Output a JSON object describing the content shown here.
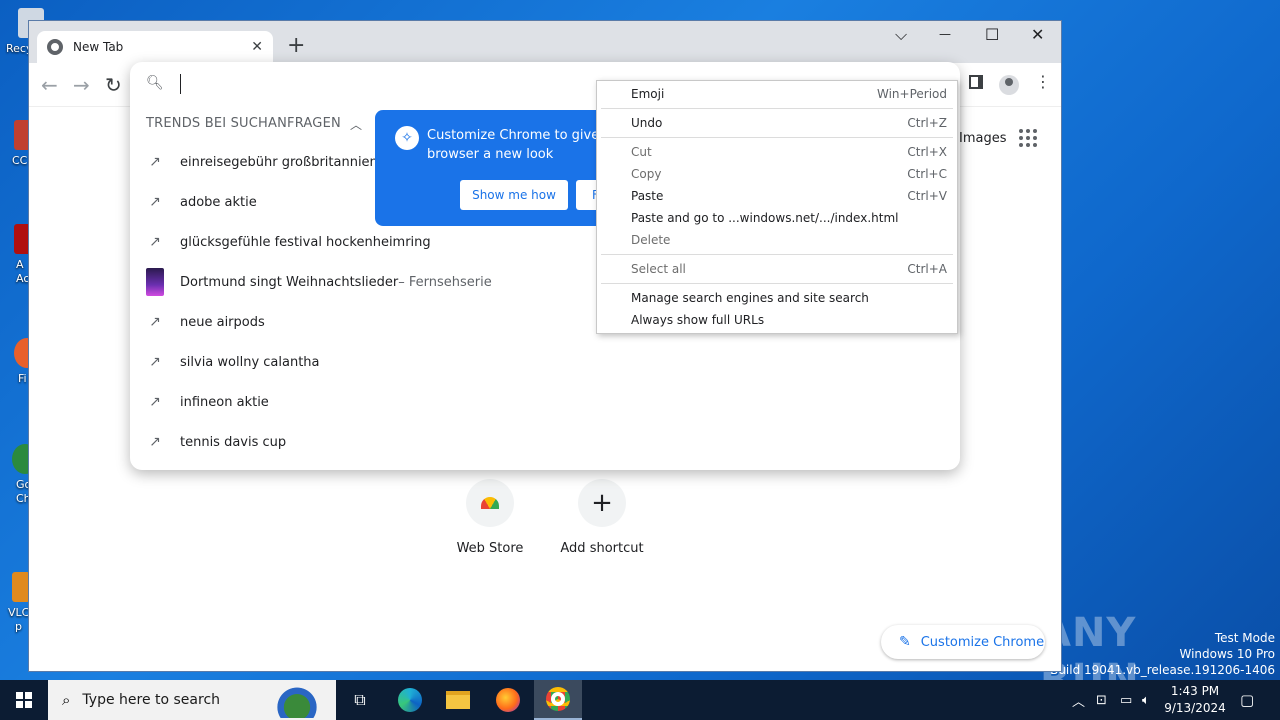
{
  "desktop": {
    "icons": [
      {
        "label": "Recy",
        "color": "#cfd8e3"
      },
      {
        "label": "CC",
        "color": "#c04030"
      },
      {
        "label": "A\nAc",
        "color": "#b01010"
      },
      {
        "label": "Fi",
        "color": "#e8602c"
      },
      {
        "label": "Go\nCh",
        "color": "#2b8a3e"
      },
      {
        "label": "VLC\np",
        "color": "#e08a1e"
      }
    ],
    "watermark": "ANY RUN",
    "test_mode_lines": [
      "Test Mode",
      "Windows 10 Pro",
      "Build 19041.vb_release.191206-1406"
    ]
  },
  "chrome": {
    "tab_title": "New Tab",
    "new_tab_symbol": "+",
    "window_controls": {
      "dropdown": "⌵",
      "minimize": "—",
      "maximize": "☐",
      "close": "✕"
    },
    "ntp": {
      "images_link": "Images",
      "shortcuts": [
        {
          "label": "Web Store"
        },
        {
          "label": "Add shortcut",
          "symbol": "+"
        }
      ],
      "customize_button": "Customize Chrome"
    },
    "omnibox": {
      "value": "",
      "trends_heading": "TRENDS BEI SUCHANFRAGEN",
      "suggestions": [
        {
          "text": "einreisegebühr großbritannien",
          "sub": "–",
          "icon": "trending-icon"
        },
        {
          "text": "adobe aktie",
          "sub": "",
          "icon": "trending-icon"
        },
        {
          "text": "glücksgefühle festival hockenheimring",
          "sub": "",
          "icon": "trending-icon"
        },
        {
          "text": "Dortmund singt Weihnachtslieder",
          "sub": " – Fernsehserie",
          "icon": "thumbnail"
        },
        {
          "text": "neue airpods",
          "sub": "",
          "icon": "trending-icon"
        },
        {
          "text": "silvia wollny calantha",
          "sub": "",
          "icon": "trending-icon"
        },
        {
          "text": "infineon aktie",
          "sub": "",
          "icon": "trending-icon"
        },
        {
          "text": "tennis davis cup",
          "sub": "",
          "icon": "trending-icon"
        }
      ]
    },
    "promo": {
      "text_line1": "Customize Chrome to give y",
      "text_line2": "browser a new look",
      "primary_button": "Show me how",
      "secondary_button": "F"
    }
  },
  "context_menu": {
    "items": [
      {
        "label": "Emoji",
        "shortcut": "Win+Period",
        "disabled": false
      },
      {
        "label": "Undo",
        "shortcut": "Ctrl+Z",
        "disabled": false
      },
      {
        "label": "Cut",
        "shortcut": "Ctrl+X",
        "disabled": true
      },
      {
        "label": "Copy",
        "shortcut": "Ctrl+C",
        "disabled": true
      },
      {
        "label": "Paste",
        "shortcut": "Ctrl+V",
        "disabled": false
      },
      {
        "label": "Paste and go to ...windows.net/.../index.html",
        "shortcut": "",
        "disabled": false
      },
      {
        "label": "Delete",
        "shortcut": "",
        "disabled": true
      },
      {
        "label": "Select all",
        "shortcut": "Ctrl+A",
        "disabled": true
      },
      {
        "label": "Manage search engines and site search",
        "shortcut": "",
        "disabled": false
      },
      {
        "label": "Always show full URLs",
        "shortcut": "",
        "disabled": false
      }
    ]
  },
  "taskbar": {
    "search_placeholder": "Type here to search",
    "time": "1:43 PM",
    "date": "9/13/2024"
  }
}
